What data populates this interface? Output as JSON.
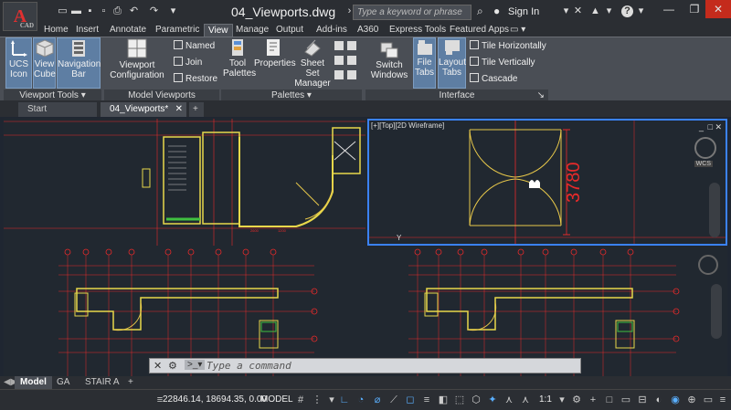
{
  "window": {
    "logo_letter": "A",
    "logo_sub": "CAD",
    "title": "04_Viewports.dwg",
    "search_placeholder": "Type a keyword or phrase",
    "signin": "Sign In"
  },
  "ribbon_tabs": [
    "Home",
    "Insert",
    "Annotate",
    "Parametric",
    "View",
    "Manage",
    "Output",
    "Add-ins",
    "A360",
    "Express Tools",
    "Featured Apps"
  ],
  "active_tab": "View",
  "panels": {
    "viewport_tools": {
      "title": "Viewport Tools",
      "buttons": [
        "UCS\nIcon",
        "View\nCube",
        "Navigation\nBar"
      ]
    },
    "model_viewports": {
      "title": "Model Viewports",
      "config": "Viewport\nConfiguration",
      "named": "Named",
      "join": "Join",
      "restore": "Restore"
    },
    "palettes": {
      "title": "Palettes",
      "tool": "Tool\nPalettes",
      "properties": "Properties",
      "sheet_set": "Sheet Set\nManager"
    },
    "interface": {
      "title": "Interface",
      "switch": "Switch\nWindows",
      "file_tabs": "File\nTabs",
      "layout_tabs": "Layout\nTabs",
      "tile_h": "Tile Horizontally",
      "tile_v": "Tile Vertically",
      "cascade": "Cascade"
    }
  },
  "file_tabs": [
    "Start",
    "04_Viewports*"
  ],
  "viewport_label": "[+][Top][2D Wireframe]",
  "dimension_text": "3780",
  "viewcube_label": "WCS",
  "axis_label": "Y",
  "command": {
    "placeholder": "Type a command"
  },
  "layout_tabs": [
    "Model",
    "GA",
    "STAIR A"
  ],
  "status": {
    "coords": "22846.14, 18694.35, 0.00",
    "model": "MODEL",
    "scale": "1:1"
  },
  "colors": {
    "walls": "#e8d84a",
    "grid": "#e82a2a",
    "dims": "#e82a2a",
    "door": "#e8c84a",
    "accent": "#e03030",
    "viewport_active_border": "#3b82f6"
  }
}
